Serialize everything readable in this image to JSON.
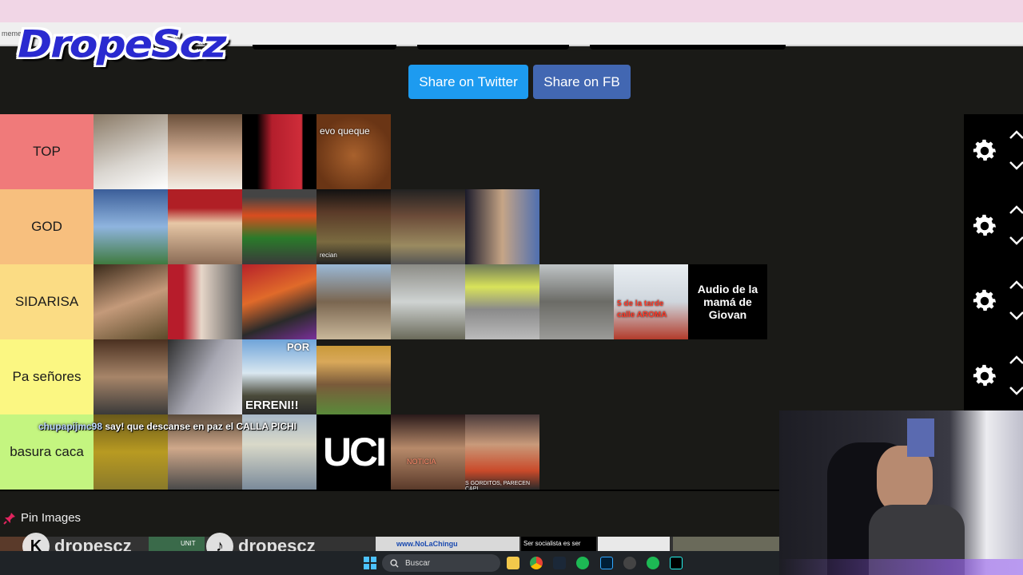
{
  "browser": {
    "url_fragment": "meme"
  },
  "brand": {
    "name": "DropeScz"
  },
  "share": {
    "twitter": "Share on Twitter",
    "facebook": "Share on FB"
  },
  "tiers": [
    {
      "label": "TOP",
      "color": "#f07a7a"
    },
    {
      "label": "GOD",
      "color": "#f7bf7e"
    },
    {
      "label": "SIDARISA",
      "color": "#fbdc84"
    },
    {
      "label": "Pa señores",
      "color": "#fbf782"
    },
    {
      "label": "basura caca",
      "color": "#c4f580"
    }
  ],
  "captions": {
    "evo": "evo queque",
    "audio": "Audio de la mamá de Giovan",
    "uc": "UCI",
    "small1": "recian",
    "aroma1": "5 de la tarde",
    "aroma2": "calle AROMA",
    "terrenito": "ERRENI!!",
    "por": "POR",
    "noticia": "NOTICIA",
    "gorditos": "S GORDITOS, PARECEN CAPI"
  },
  "overlay": {
    "user": "chupapijmc98",
    "message": "say! que descanse en paz el CALLA PICHI"
  },
  "pin": {
    "label": "Pin Images"
  },
  "stream": {
    "watermark": "dropescz",
    "strip1": "www.NoLaChingu",
    "strip2": "Ser socialista es ser",
    "strip3": "UNIT"
  },
  "taskbar": {
    "search_placeholder": "Buscar"
  }
}
